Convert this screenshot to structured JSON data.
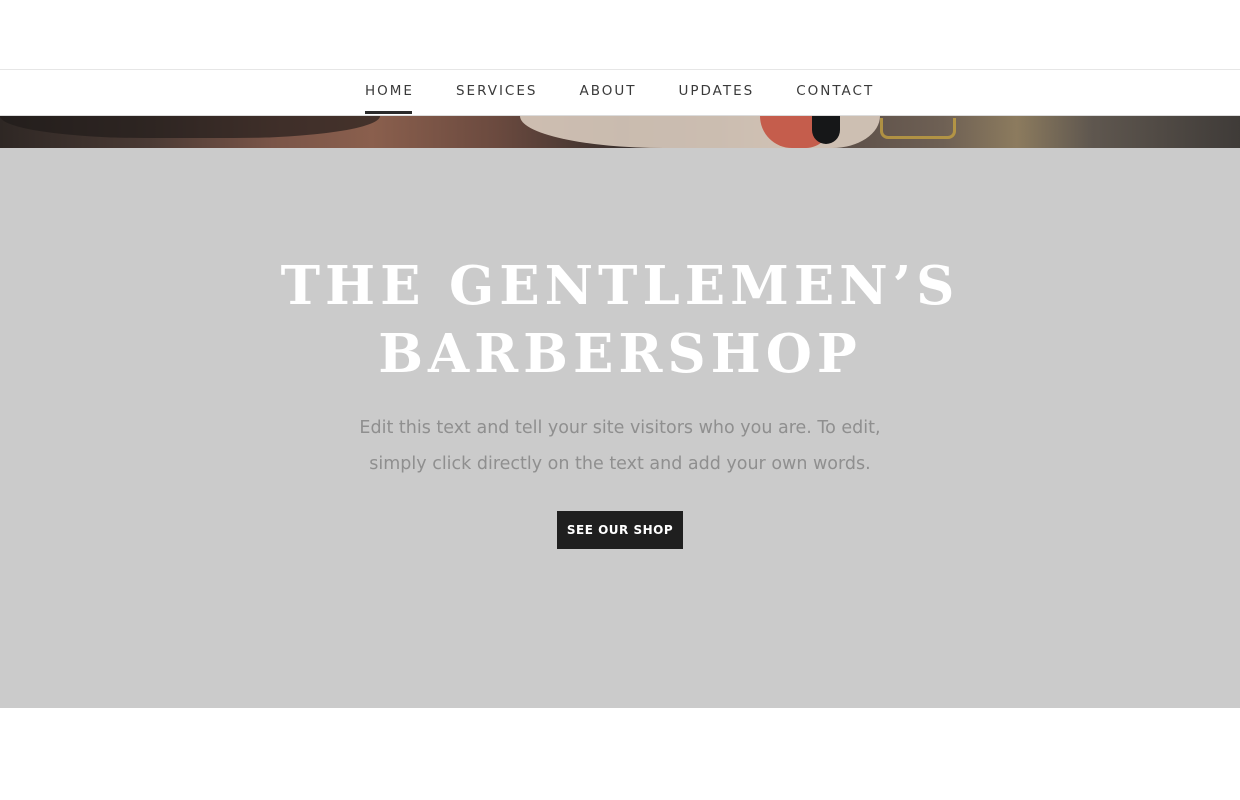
{
  "nav": {
    "items": [
      {
        "label": "HOME",
        "active": true
      },
      {
        "label": "SERVICES",
        "active": false
      },
      {
        "label": "ABOUT",
        "active": false
      },
      {
        "label": "UPDATES",
        "active": false
      },
      {
        "label": "CONTACT",
        "active": false
      }
    ]
  },
  "hero": {
    "title_line1": "THE GENTLEMEN’S",
    "title_line2": "BARBERSHOP",
    "text_line1": "Edit this text and tell your site visitors who you are. To edit,",
    "text_line2": "simply click directly on the text and add your own words.",
    "button_label": "SEE OUR SHOP"
  },
  "colors": {
    "hero_background": "#cbcbcb",
    "button_background": "#1f1f1f",
    "title_color": "#ffffff",
    "text_color": "#8f8f8f"
  }
}
